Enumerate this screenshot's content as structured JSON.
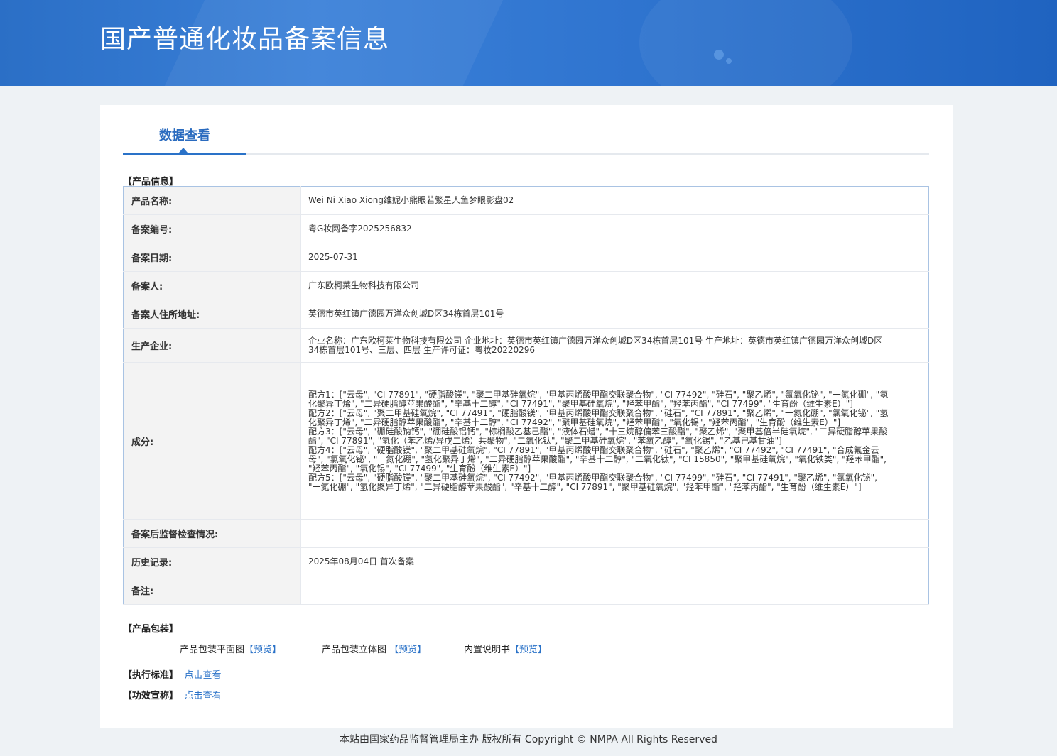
{
  "banner": {
    "title": "国产普通化妆品备案信息"
  },
  "tab": {
    "label": "数据查看"
  },
  "product_info": {
    "section_title": "【产品信息】",
    "rows": [
      {
        "label": "产品名称:",
        "value": "Wei Ni Xiao Xiong维妮小熊眼若繁星人鱼梦眼影盘02"
      },
      {
        "label": "备案编号:",
        "value": "粤G妆网备字2025256832"
      },
      {
        "label": "备案日期:",
        "value": "2025-07-31"
      },
      {
        "label": "备案人:",
        "value": "广东欧柯莱生物科技有限公司"
      },
      {
        "label": "备案人住所地址:",
        "value": "英德市英红镇广德园万洋众创城D区34栋首层101号"
      },
      {
        "label": "生产企业:",
        "value": "企业名称：广东欧柯莱生物科技有限公司 企业地址：英德市英红镇广德园万洋众创城D区34栋首层101号 生产地址：英德市英红镇广德园万洋众创城D区34栋首层101号、三层、四层 生产许可证：粤妆20220296"
      },
      {
        "label": "成分:",
        "value": ""
      },
      {
        "label": "备案后监督检查情况:",
        "value": ""
      },
      {
        "label": "历史记录:",
        "value": "2025年08月04日 首次备案"
      },
      {
        "label": "备注:",
        "value": ""
      }
    ],
    "ingredients": [
      "配方1：[\"云母\", \"CI 77891\", \"硬脂酸镁\", \"聚二甲基硅氧烷\", \"甲基丙烯酸甲酯交联聚合物\", \"CI 77492\", \"硅石\", \"聚乙烯\", \"氯氧化铋\", \"一氮化硼\", \"氢化聚异丁烯\", \"二异硬脂醇苹果酸酯\", \"辛基十二醇\", \"CI 77491\", \"聚甲基硅氧烷\", \"羟苯甲酯\", \"羟苯丙酯\", \"CI 77499\", \"生育酚（维生素E）\"]",
      "配方2：[\"云母\", \"聚二甲基硅氧烷\", \"CI 77491\", \"硬脂酸镁\", \"甲基丙烯酸甲酯交联聚合物\", \"硅石\", \"CI 77891\", \"聚乙烯\", \"一氮化硼\", \"氯氧化铋\", \"氢化聚异丁烯\", \"二异硬脂醇苹果酸酯\", \"辛基十二醇\", \"CI 77492\", \"聚甲基硅氧烷\", \"羟苯甲酯\", \"氧化锡\", \"羟苯丙酯\", \"生育酚（维生素E）\"]",
      "配方3：[\"云母\", \"硼硅酸钠钙\", \"硼硅酸铝钙\", \"棕榈酸乙基己酯\", \"液体石蜡\", \"十三烷醇偏苯三酸酯\", \"聚乙烯\", \"聚甲基倍半硅氧烷\", \"二异硬脂醇苹果酸酯\", \"CI 77891\", \"氢化（苯乙烯/异戊二烯）共聚物\", \"二氧化钛\", \"聚二甲基硅氧烷\", \"苯氧乙醇\", \"氧化锡\", \"乙基己基甘油\"]",
      "配方4：[\"云母\", \"硬脂酸镁\", \"聚二甲基硅氧烷\", \"CI 77891\", \"甲基丙烯酸甲酯交联聚合物\", \"硅石\", \"聚乙烯\", \"CI 77492\", \"CI 77491\", \"合成氟金云母\", \"氯氧化铋\", \"一氮化硼\", \"氢化聚异丁烯\", \"二异硬脂醇苹果酸酯\", \"辛基十二醇\", \"二氧化钛\", \"CI 15850\", \"聚甲基硅氧烷\", \"氧化铁类\", \"羟苯甲酯\", \"羟苯丙酯\", \"氧化锡\", \"CI 77499\", \"生育酚（维生素E）\"]",
      "配方5：[\"云母\", \"硬脂酸镁\", \"聚二甲基硅氧烷\", \"CI 77492\", \"甲基丙烯酸甲酯交联聚合物\", \"CI 77499\", \"硅石\", \"CI 77491\", \"聚乙烯\", \"氯氧化铋\", \"一氮化硼\", \"氢化聚异丁烯\", \"二异硬脂醇苹果酸酯\", \"辛基十二醇\", \"CI 77891\", \"聚甲基硅氧烷\", \"羟苯甲酯\", \"羟苯丙酯\", \"生育酚（维生素E）\"]"
    ]
  },
  "packaging": {
    "section_title": "【产品包装】",
    "items": [
      {
        "label": "产品包装平面图",
        "link": "【预览】"
      },
      {
        "label": "产品包装立体图 ",
        "link": "【预览】"
      },
      {
        "label": "内置说明书",
        "link": "【预览】"
      }
    ]
  },
  "standard": {
    "label": "【执行标准】",
    "link": "点击查看"
  },
  "efficacy": {
    "label": "【功效宣称】",
    "link": "点击查看"
  },
  "footer": {
    "text": "本站由国家药品监督管理局主办 版权所有 Copyright © NMPA All Rights Reserved"
  }
}
